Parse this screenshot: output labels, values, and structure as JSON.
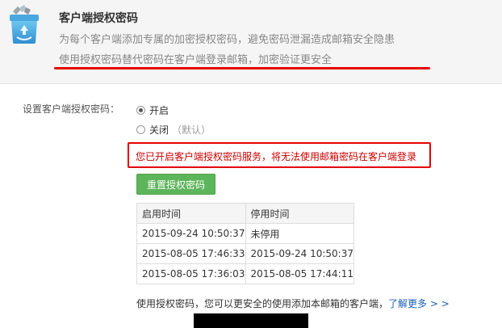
{
  "header": {
    "title": "客户端授权密码",
    "desc_line1": "为每个客户端添加专属的加密授权密码，避免密码泄漏造成邮箱安全隐患",
    "desc_line2": "使用授权密码替代密码在客户端登录邮箱，加密验证更安全",
    "icon": "recycle-box-icon"
  },
  "setting": {
    "label": "设置客户端授权密码：",
    "options": [
      {
        "label": "开启",
        "hint": "",
        "checked": true
      },
      {
        "label": "关闭",
        "hint": "（默认）",
        "checked": false
      }
    ]
  },
  "warning": {
    "text": "您已开启客户端授权密码服务，将无法使用邮箱密码在客户端登录",
    "color": "#e60000"
  },
  "reset_button": {
    "label": "重置授权密码",
    "color": "#5db55b"
  },
  "history_table": {
    "headers": [
      "启用时间",
      "停用时间"
    ],
    "rows": [
      [
        "2015-09-24 10:50:37",
        "未停用"
      ],
      [
        "2015-08-05 17:46:33",
        "2015-09-24 10:50:37"
      ],
      [
        "2015-08-05 17:36:03",
        "2015-08-05 17:44:11"
      ]
    ]
  },
  "footer": {
    "note": "使用授权密码，您可以更安全的使用添加本邮箱的客户端，",
    "link": "了解更多 > >",
    "link_color": "#1a5fb4"
  }
}
